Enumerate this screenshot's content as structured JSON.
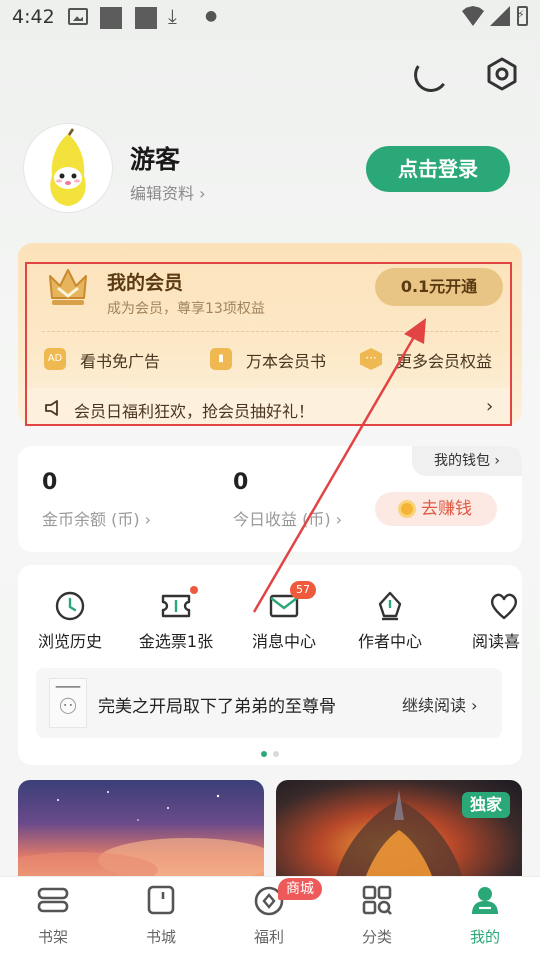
{
  "status_bar": {
    "time": "4:42"
  },
  "header": {
    "night_mode_icon": "moon-icon",
    "settings_icon": "gear-icon"
  },
  "profile": {
    "username": "游客",
    "edit_profile": "编辑资料 ›",
    "login_button": "点击登录"
  },
  "vip": {
    "title": "我的会员",
    "subtitle": "成为会员，尊享13项权益",
    "open_button": "0.1元开通",
    "benefits": [
      {
        "label": "看书免广告",
        "icon": "ad-icon"
      },
      {
        "label": "万本会员书",
        "icon": "book-icon"
      },
      {
        "label": "更多会员权益",
        "icon": "more-icon"
      }
    ],
    "banner_text": "会员日福利狂欢，抢会员抽好礼！",
    "banner_arrow": "›"
  },
  "wallet": {
    "tab_label": "我的钱包 ›",
    "coin_value": "0",
    "coin_label": "金币余额 (币) ›",
    "earn_value": "0",
    "earn_label": "今日收益 (币) ›",
    "earn_button": "去赚钱"
  },
  "tools": {
    "items": [
      {
        "label": "浏览历史",
        "icon": "clock-icon"
      },
      {
        "label": "金选票1张",
        "icon": "ticket-icon"
      },
      {
        "label": "消息中心",
        "icon": "message-icon",
        "badge": "57"
      },
      {
        "label": "作者中心",
        "icon": "pen-icon"
      },
      {
        "label": "阅读喜",
        "icon": "heart-icon"
      }
    ],
    "recent_book_title": "完美之开局取下了弟弟的至尊骨",
    "continue_reading": "继续阅读 ›"
  },
  "banners": {
    "exclusive_tag": "独家"
  },
  "bottom_nav": {
    "items": [
      {
        "label": "书架",
        "icon": "bookshelf-icon"
      },
      {
        "label": "书城",
        "icon": "bookstore-icon"
      },
      {
        "label": "福利",
        "icon": "welfare-icon"
      },
      {
        "label": "分类",
        "icon": "category-icon"
      },
      {
        "label": "我的",
        "icon": "profile-icon"
      }
    ],
    "mall_badge": "商城",
    "active_index": 4
  },
  "colors": {
    "accent": "#2aa877",
    "vip_gold": "#e9c585",
    "alert_red": "#ee5a3c",
    "annotation": "#e24444"
  }
}
